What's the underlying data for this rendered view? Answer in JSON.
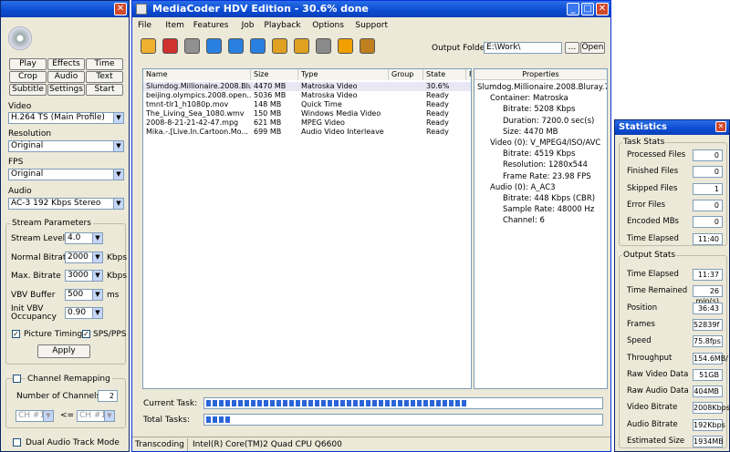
{
  "left_panel": {
    "buttons": [
      "Play",
      "Effects",
      "Time",
      "Crop",
      "Audio",
      "Text",
      "Subtitle",
      "Settings",
      "Start"
    ],
    "video_label": "Video",
    "video_value": "H.264 TS (Main Profile)",
    "resolution_label": "Resolution",
    "resolution_value": "Original",
    "fps_label": "FPS",
    "fps_value": "Original",
    "audio_label": "Audio",
    "audio_value": "AC-3 192 Kbps Stereo",
    "stream_title": "Stream Parameters",
    "stream_level_label": "Stream Level",
    "stream_level_value": "4.0",
    "normal_bitrate_label": "Normal Bitrate",
    "normal_bitrate_value": "2000",
    "kbps1": "Kbps",
    "max_bitrate_label": "Max. Bitrate",
    "max_bitrate_value": "3000",
    "kbps2": "Kbps",
    "vbv_buffer_label": "VBV Buffer",
    "vbv_buffer_value": "500",
    "ms": "ms",
    "init_vbv_label1": "Init VBV",
    "init_vbv_label2": "Occupancy",
    "init_vbv_value": "0.90",
    "picture_timing": "Picture Timing",
    "sps_pps": "SPS/PPS",
    "apply": "Apply",
    "channel_remapping": "Channel Remapping",
    "num_channels_label": "Number of Channels:",
    "num_channels_value": "2",
    "ch_left": "CH #1",
    "ch_right": "CH #1",
    "map_sym": "<=",
    "dual_audio": "Dual Audio Track Mode"
  },
  "main": {
    "title": "MediaCoder HDV Edition - 30.6% done",
    "menu": [
      "File",
      "Item",
      "Features",
      "Job",
      "Playback",
      "Options",
      "Support"
    ],
    "output_folder_label": "Output Folder",
    "output_folder_value": "E:\\Work\\",
    "browse": "...",
    "open": "Open",
    "columns": [
      "Name",
      "Size",
      "Type",
      "Group",
      "State",
      "F"
    ],
    "files": [
      {
        "name": "Slumdog.Millionaire.2008.Blu...",
        "size": "4470 MB",
        "type": "Matroska Video",
        "state": "30.6%"
      },
      {
        "name": "beijing.olympics.2008.open...",
        "size": "5036 MB",
        "type": "Matroska Video",
        "state": "Ready"
      },
      {
        "name": "tmnt-tlr1_h1080p.mov",
        "size": "148 MB",
        "type": "Quick Time",
        "state": "Ready"
      },
      {
        "name": "The_Living_Sea_1080.wmv",
        "size": "150 MB",
        "type": "Windows Media Video",
        "state": "Ready"
      },
      {
        "name": "2008-8-21-21-42-47.mpg",
        "size": "621 MB",
        "type": "MPEG Video",
        "state": "Ready"
      },
      {
        "name": "Mika.-.[Live.In.Cartoon.Mo...",
        "size": "699 MB",
        "type": "Audio Video Interleave",
        "state": "Ready"
      }
    ],
    "properties_header": "Properties",
    "properties": [
      "Slumdog.Millionaire.2008.Bluray.720p.",
      "Container: Matroska",
      "Bitrate: 5208 Kbps",
      "Duration: 7200.0 sec(s)",
      "Size: 4470 MB",
      "Video (0): V_MPEG4/ISO/AVC",
      "Bitrate: 4519 Kbps",
      "Resolution: 1280x544",
      "Frame Rate: 23.98 FPS",
      "Audio (0): A_AC3",
      "Bitrate: 448 Kbps (CBR)",
      "Sample Rate: 48000 Hz",
      "Channel: 6"
    ],
    "current_task_label": "Current Task:",
    "total_tasks_label": "Total Tasks:",
    "current_task_progress": 0.66,
    "total_tasks_progress": 0.06,
    "status_left": "Transcoding",
    "status_cpu": "Intel(R) Core(TM)2 Quad CPU Q6600"
  },
  "stats": {
    "title": "Statistics",
    "task_stats_title": "Task Stats",
    "task_stats": [
      {
        "label": "Processed Files",
        "value": "0"
      },
      {
        "label": "Finished Files",
        "value": "0"
      },
      {
        "label": "Skipped Files",
        "value": "1"
      },
      {
        "label": "Error Files",
        "value": "0"
      },
      {
        "label": "Encoded MBs",
        "value": "0"
      },
      {
        "label": "Time Elapsed",
        "value": "11:40"
      }
    ],
    "output_stats_title": "Output Stats",
    "output_stats": [
      {
        "label": "Time Elapsed",
        "value": "11:37"
      },
      {
        "label": "Time Remained",
        "value": "26 min(s)"
      },
      {
        "label": "Position",
        "value": "36:43"
      },
      {
        "label": "Frames",
        "value": "52839f"
      },
      {
        "label": "Speed",
        "value": "75.8fps"
      },
      {
        "label": "Throughput",
        "value": "154.6MB/"
      },
      {
        "label": "Raw Video Data",
        "value": "51GB"
      },
      {
        "label": "Raw Audio Data",
        "value": "404MB"
      },
      {
        "label": "Video Bitrate",
        "value": "2008Kbps"
      },
      {
        "label": "Audio Bitrate",
        "value": "192Kbps"
      },
      {
        "label": "Estimated Size",
        "value": "1934MB"
      }
    ]
  },
  "colors": {
    "title_blue": "#0b4bd1",
    "progress_blue": "#2a64d8"
  }
}
